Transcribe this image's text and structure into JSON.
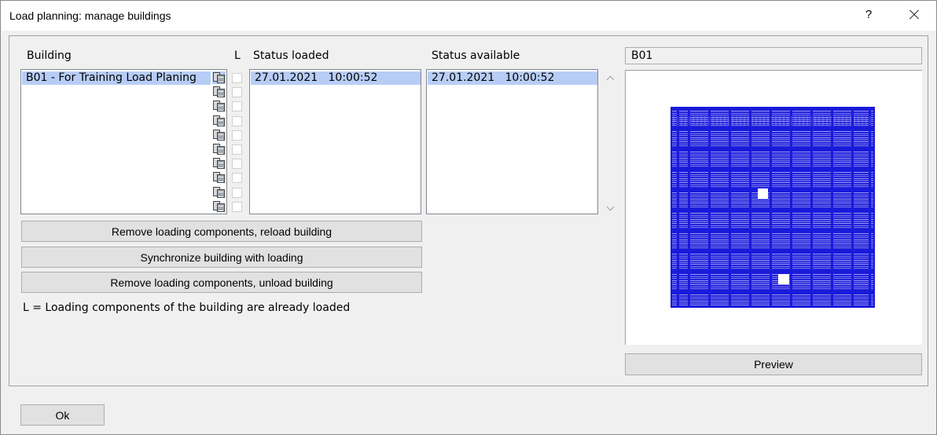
{
  "window": {
    "title": "Load planning: manage buildings",
    "help_label": "?"
  },
  "columns": {
    "building": "Building",
    "loaded_flag": "L",
    "status_loaded": "Status loaded",
    "status_available": "Status available"
  },
  "buildings": [
    {
      "name": "B01 - For Training Load Planing",
      "loaded": false,
      "status_loaded": "27.01.2021   10:00:52",
      "status_available": "27.01.2021   10:00:52",
      "selected": true
    }
  ],
  "icon_rows": 10,
  "buttons": {
    "reload": "Remove loading components, reload building",
    "sync": "Synchronize building with loading",
    "unload": "Remove loading components, unload building",
    "preview": "Preview",
    "ok": "Ok"
  },
  "legend": "L = Loading components of the building are already loaded",
  "preview_panel": {
    "building_code": "B01",
    "plan_color": "#1a1adb"
  },
  "icons": {
    "building_icon": "building-icon",
    "close": "close-icon",
    "scroll_up": "chevron-up-icon",
    "scroll_down": "chevron-down-icon"
  }
}
